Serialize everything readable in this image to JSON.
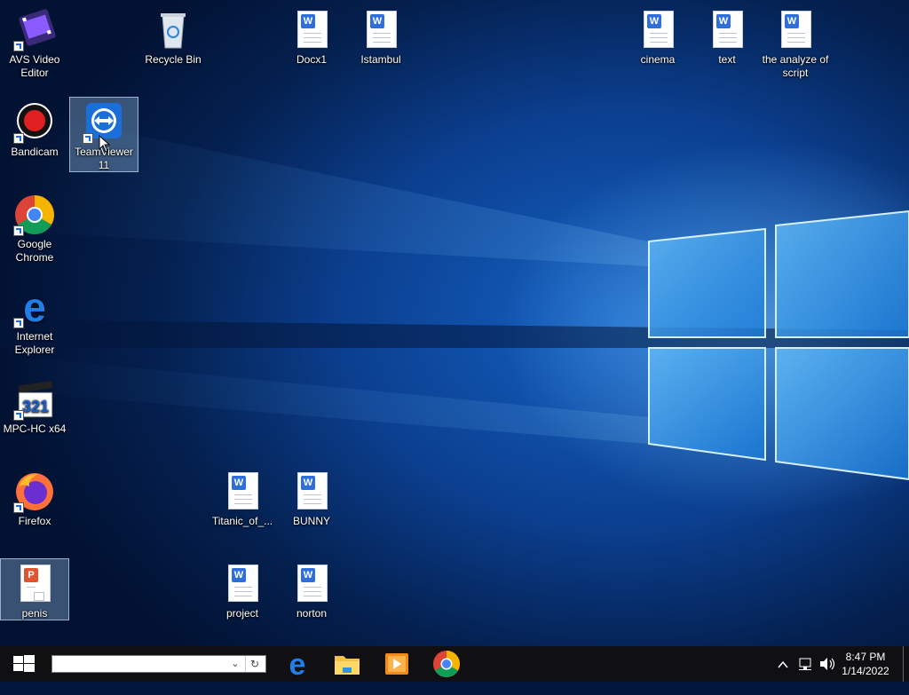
{
  "desktop": {
    "icons": [
      {
        "label": "AVS Video Editor",
        "type": "app"
      },
      {
        "label": "Recycle Bin",
        "type": "system"
      },
      {
        "label": "Docx1",
        "type": "doc"
      },
      {
        "label": "Istambul",
        "type": "doc"
      },
      {
        "label": "cinema",
        "type": "doc"
      },
      {
        "label": "text",
        "type": "doc"
      },
      {
        "label": "the analyze of script",
        "type": "doc"
      },
      {
        "label": "Bandicam",
        "type": "app"
      },
      {
        "label": "TeamViewer 11",
        "type": "app",
        "selected": true
      },
      {
        "label": "Google Chrome",
        "type": "app"
      },
      {
        "label": "Internet Explorer",
        "type": "app"
      },
      {
        "label": "MPC-HC x64",
        "type": "app"
      },
      {
        "label": "Firefox",
        "type": "app"
      },
      {
        "label": "Titanic_of_...",
        "type": "doc"
      },
      {
        "label": "BUNNY",
        "type": "doc"
      },
      {
        "label": "penis",
        "type": "ppt",
        "selected": true
      },
      {
        "label": "project",
        "type": "doc"
      },
      {
        "label": "norton",
        "type": "doc"
      }
    ]
  },
  "doc_badge": "W",
  "ppt_badge": "P",
  "mpc_badge": "321",
  "taskbar": {
    "search_value": "",
    "pinned": [
      "edge-icon",
      "file-explorer-icon",
      "media-player-icon",
      "chrome-icon"
    ],
    "clock_time": "8:47 PM",
    "clock_date": "1/14/2022"
  },
  "colors": {
    "wallpaper_blue": "#0b3f8f",
    "taskbar": "#101012",
    "word_blue": "#2f6fdc"
  }
}
